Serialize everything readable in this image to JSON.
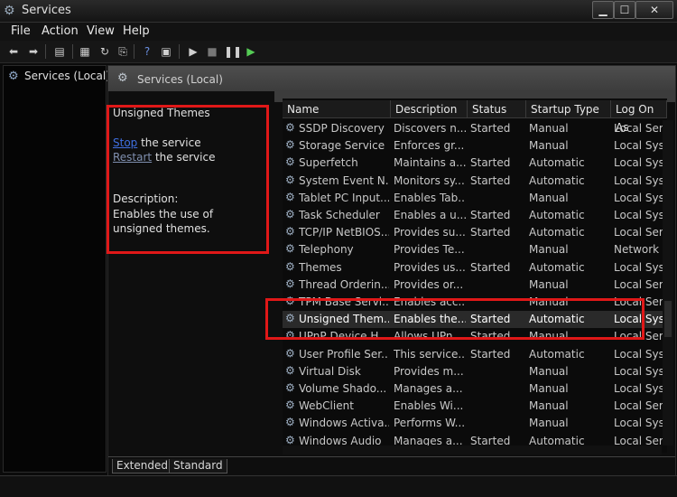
{
  "window": {
    "title": "Services"
  },
  "menu": [
    "File",
    "Action",
    "View",
    "Help"
  ],
  "toolbar": {
    "icons": [
      "back-icon",
      "forward-icon",
      "console-tree-icon",
      "properties-icon",
      "refresh-icon",
      "export-list-icon",
      "help-icon",
      "show-hide-icon",
      "start-icon",
      "stop-icon",
      "pause-icon",
      "restart-icon"
    ]
  },
  "tree": {
    "root_label": "Services (Local)"
  },
  "pane": {
    "header_title": "Services (Local)"
  },
  "extended": {
    "service_name": "Unsigned Themes",
    "stop_link": "Stop",
    "stop_suffix": " the service",
    "restart_link": "Restart",
    "restart_suffix": " the service",
    "description_label": "Description:",
    "description_text": "Enables the use of unsigned themes."
  },
  "table": {
    "columns": [
      "Name",
      "Description",
      "Status",
      "Startup Type",
      "Log On As"
    ],
    "rows": [
      {
        "name": "SSDP Discovery",
        "description": "Discovers n...",
        "status": "Started",
        "startup": "Manual",
        "logon": "Local Ser"
      },
      {
        "name": "Storage Service",
        "description": "Enforces gr...",
        "status": "",
        "startup": "Manual",
        "logon": "Local Sys"
      },
      {
        "name": "Superfetch",
        "description": "Maintains a...",
        "status": "Started",
        "startup": "Automatic",
        "logon": "Local Sys"
      },
      {
        "name": "System Event N...",
        "description": "Monitors sy...",
        "status": "Started",
        "startup": "Automatic",
        "logon": "Local Sys"
      },
      {
        "name": "Tablet PC Input...",
        "description": "Enables Tab...",
        "status": "",
        "startup": "Manual",
        "logon": "Local Sys"
      },
      {
        "name": "Task Scheduler",
        "description": "Enables a u...",
        "status": "Started",
        "startup": "Automatic",
        "logon": "Local Sys"
      },
      {
        "name": "TCP/IP NetBIOS...",
        "description": "Provides su...",
        "status": "Started",
        "startup": "Automatic",
        "logon": "Local Ser"
      },
      {
        "name": "Telephony",
        "description": "Provides Te...",
        "status": "",
        "startup": "Manual",
        "logon": "Network"
      },
      {
        "name": "Themes",
        "description": "Provides us...",
        "status": "Started",
        "startup": "Automatic",
        "logon": "Local Sys"
      },
      {
        "name": "Thread Orderin...",
        "description": "Provides or...",
        "status": "",
        "startup": "Manual",
        "logon": "Local Ser"
      },
      {
        "name": "TPM Base Servi...",
        "description": "Enables acc...",
        "status": "",
        "startup": "Manual",
        "logon": "Local Ser"
      },
      {
        "name": "Unsigned Them...",
        "description": "Enables the...",
        "status": "Started",
        "startup": "Automatic",
        "logon": "Local Sys"
      },
      {
        "name": "UPnP Device H...",
        "description": "Allows UPn...",
        "status": "Started",
        "startup": "Manual",
        "logon": "Local Ser"
      },
      {
        "name": "User Profile Ser...",
        "description": "This service...",
        "status": "Started",
        "startup": "Automatic",
        "logon": "Local Sys"
      },
      {
        "name": "Virtual Disk",
        "description": "Provides m...",
        "status": "",
        "startup": "Manual",
        "logon": "Local Sys"
      },
      {
        "name": "Volume Shado...",
        "description": "Manages a...",
        "status": "",
        "startup": "Manual",
        "logon": "Local Sys"
      },
      {
        "name": "WebClient",
        "description": "Enables Wi...",
        "status": "",
        "startup": "Manual",
        "logon": "Local Ser"
      },
      {
        "name": "Windows Activa...",
        "description": "Performs W...",
        "status": "",
        "startup": "Manual",
        "logon": "Local Sys"
      },
      {
        "name": "Windows Audio",
        "description": "Manages a...",
        "status": "Started",
        "startup": "Automatic",
        "logon": "Local Ser"
      }
    ],
    "selected_index": 11
  },
  "tabs": [
    "Extended",
    "Standard"
  ],
  "colors": {
    "highlight_box": "#e01818",
    "link": "#3f6fe0",
    "background": "#0b0b0b"
  }
}
